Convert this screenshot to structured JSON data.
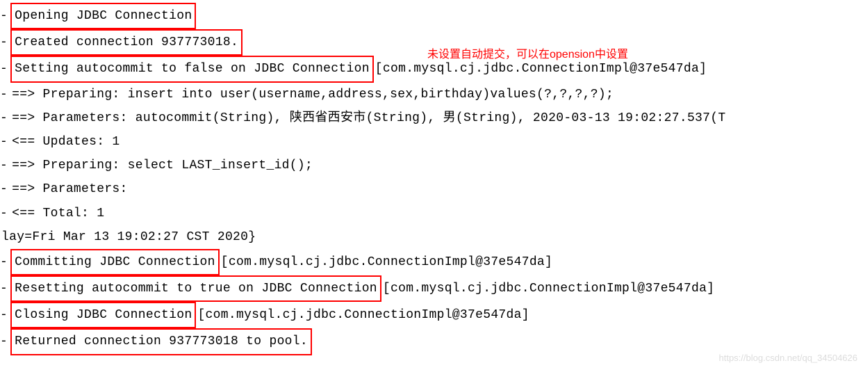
{
  "annotation": "未设置自动提交，可以在opension中设置",
  "watermark": "https://blog.csdn.net/qq_34504626",
  "lines": [
    {
      "dash": "-",
      "boxed": "Opening JDBC Connection",
      "after": ""
    },
    {
      "dash": "-",
      "boxed": "Created connection 937773018.",
      "after": ""
    },
    {
      "dash": "-",
      "boxed": "Setting autocommit to false on JDBC Connection",
      "after": " [com.mysql.cj.jdbc.ConnectionImpl@37e547da]"
    },
    {
      "dash": "-",
      "boxed": "",
      "after": " ==>  Preparing: insert into user(username,address,sex,birthday)values(?,?,?,?);"
    },
    {
      "dash": "-",
      "boxed": "",
      "after": " ==> Parameters: autocommit(String), 陕西省西安市(String), 男(String), 2020-03-13 19:02:27.537(T"
    },
    {
      "dash": "-",
      "boxed": "",
      "after": " <==    Updates: 1"
    },
    {
      "dash": "-",
      "boxed": "",
      "after": " ==>  Preparing: select LAST_insert_id();"
    },
    {
      "dash": "-",
      "boxed": "",
      "after": " ==> Parameters:"
    },
    {
      "dash": "-",
      "boxed": "",
      "after": " <==      Total: 1"
    },
    {
      "dash": "",
      "boxed": "",
      "after": "lay=Fri Mar 13 19:02:27 CST 2020}"
    },
    {
      "dash": "-",
      "boxed": "Committing JDBC Connection",
      "after": " [com.mysql.cj.jdbc.ConnectionImpl@37e547da]"
    },
    {
      "dash": "-",
      "boxed": "Resetting autocommit to true on JDBC Connection",
      "after": " [com.mysql.cj.jdbc.ConnectionImpl@37e547da]"
    },
    {
      "dash": "-",
      "boxed": "Closing JDBC Connection",
      "after": " [com.mysql.cj.jdbc.ConnectionImpl@37e547da]"
    },
    {
      "dash": "-",
      "boxed": "Returned connection 937773018 to pool.",
      "after": ""
    }
  ]
}
